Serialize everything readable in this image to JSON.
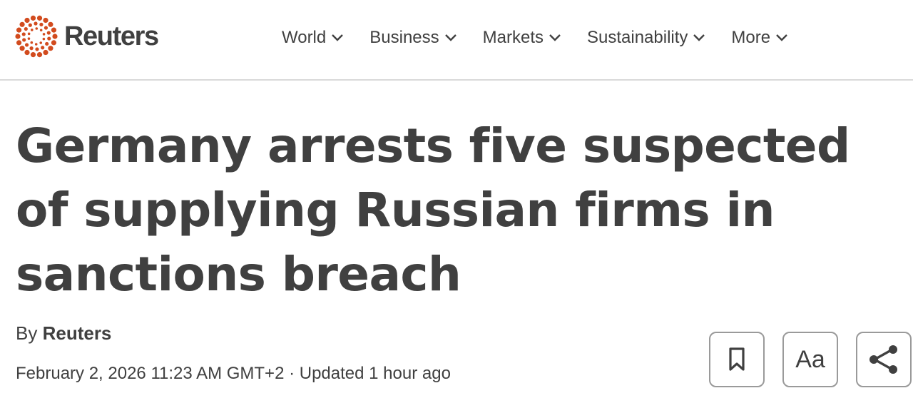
{
  "header": {
    "logo_text": "Reuters",
    "nav": [
      {
        "label": "World",
        "icon": "chevron-down-icon"
      },
      {
        "label": "Business",
        "icon": "chevron-down-icon"
      },
      {
        "label": "Markets",
        "icon": "chevron-down-icon"
      },
      {
        "label": "Sustainability",
        "icon": "chevron-down-icon"
      },
      {
        "label": "More",
        "icon": "chevron-down-icon"
      }
    ]
  },
  "article": {
    "headline": "Germany arrests five suspected of supplying Russian firms in sanctions breach",
    "byline_prefix": "By",
    "author": "Reuters",
    "dateline": "February 2, 2026 11:23 AM GMT+2 · Updated 1 hour ago"
  },
  "tools": {
    "bookmark_icon": "bookmark-icon",
    "font_size_label": "Aa",
    "share_icon": "share-icon"
  },
  "colors": {
    "brand_orange": "#d24b1e",
    "text": "#404040",
    "border": "#9a9a9a",
    "divider": "#d9d9d9"
  }
}
